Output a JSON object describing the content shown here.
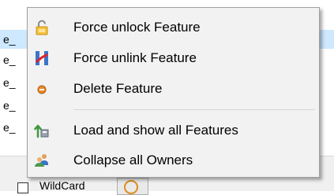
{
  "background_list": {
    "rows": [
      "e_",
      "e_",
      "e_",
      "e_",
      "e_"
    ]
  },
  "bottom_bar": {
    "wildcard_label": "WildCard"
  },
  "context_menu": {
    "items": [
      {
        "label": "Force unlock Feature",
        "icon": "unlock-icon"
      },
      {
        "label": "Force unlink Feature",
        "icon": "unlink-icon"
      },
      {
        "label": "Delete Feature",
        "icon": "delete-icon"
      },
      {
        "label": "Load and show all Features",
        "icon": "load-all-icon"
      },
      {
        "label": "Collapse all Owners",
        "icon": "collapse-owners-icon"
      }
    ]
  },
  "colors": {
    "menu_background": "#f2f2f2",
    "selection": "#cde8ff",
    "accent_orange": "#e08c1a"
  }
}
